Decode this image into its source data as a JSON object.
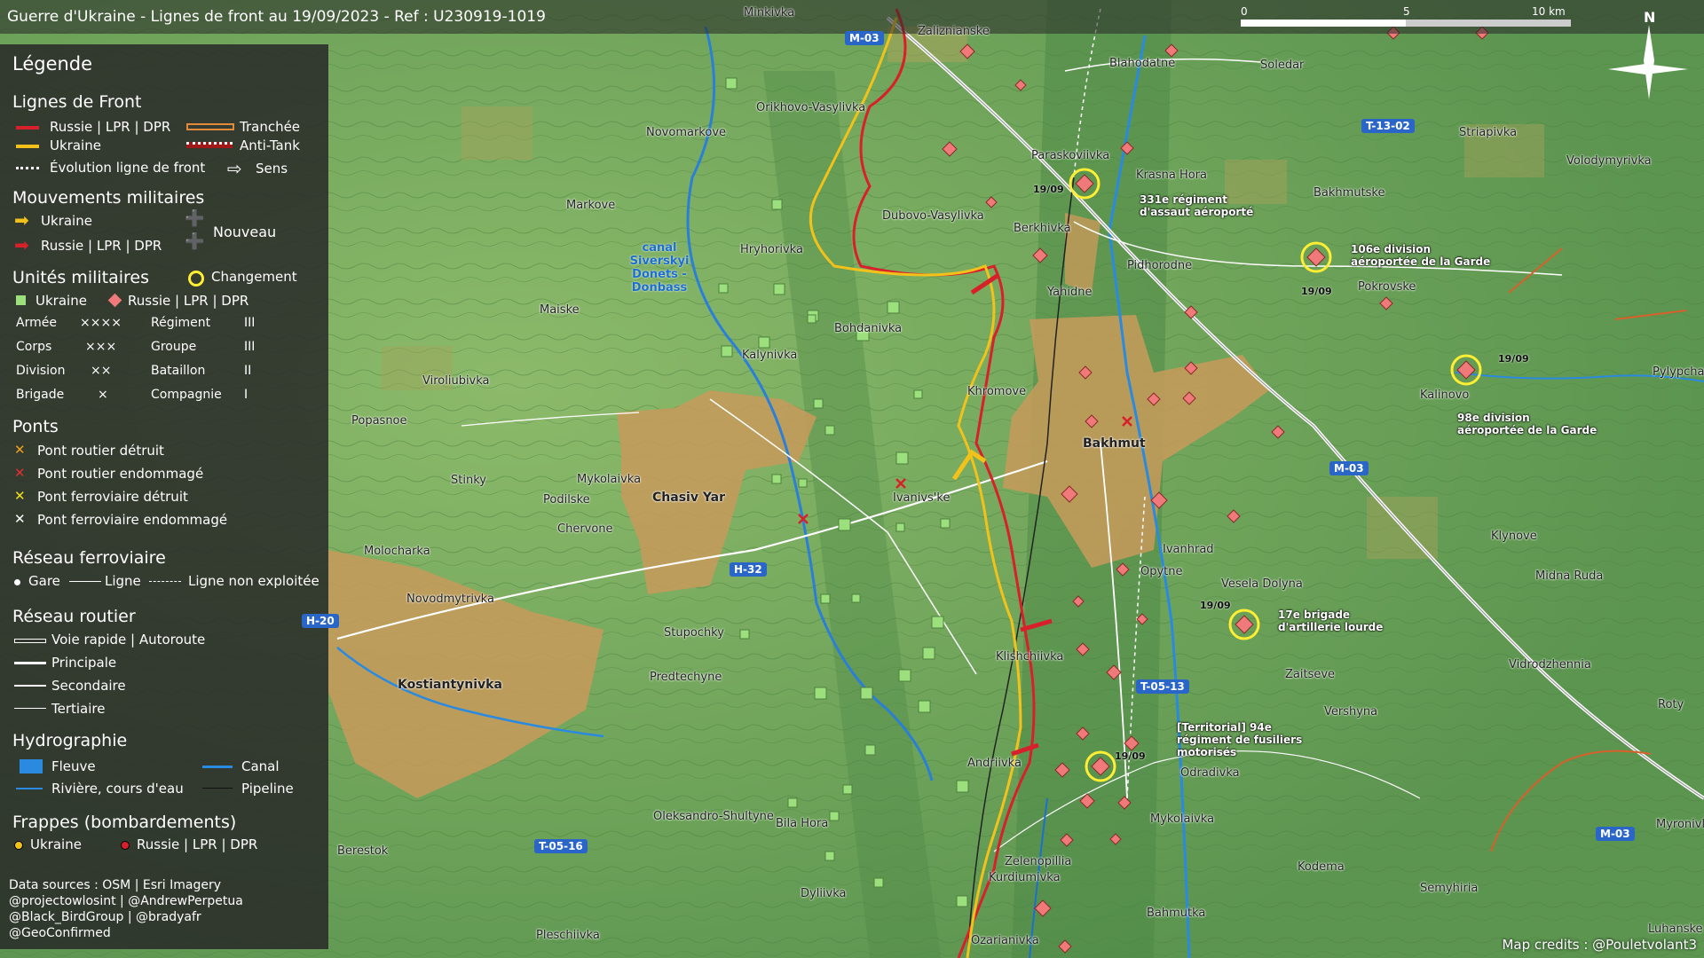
{
  "title": "Guerre d'Ukraine - Lignes de front au 19/09/2023 - Ref : U230919-1019",
  "scale": {
    "zero": "0",
    "mid": "5",
    "end": "10 km"
  },
  "north_label": "N",
  "legend": {
    "title": "Légende",
    "front_lines": {
      "heading": "Lignes de Front",
      "russia": "Russie | LPR | DPR",
      "ukraine": "Ukraine",
      "trench": "Tranchée",
      "antitank": "Anti-Tank",
      "evolution": "Évolution ligne de front",
      "direction": "Sens"
    },
    "movements": {
      "heading": "Mouvements militaires",
      "ukraine": "Ukraine",
      "russia": "Russie | LPR | DPR",
      "new": "Nouveau"
    },
    "units": {
      "heading": "Unités militaires",
      "change": "Changement",
      "ukraine": "Ukraine",
      "russia": "Russie | LPR | DPR",
      "rows": [
        {
          "left": "Armée",
          "left_sym": "××××",
          "right": "Régiment",
          "right_sym": "III"
        },
        {
          "left": "Corps",
          "left_sym": "×××",
          "right": "Groupe",
          "right_sym": "III"
        },
        {
          "left": "Division",
          "left_sym": "××",
          "right": "Bataillon",
          "right_sym": "II"
        },
        {
          "left": "Brigade",
          "left_sym": "×",
          "right": "Compagnie",
          "right_sym": "I"
        }
      ]
    },
    "bridges": {
      "heading": "Ponts",
      "items": [
        "Pont routier détruit",
        "Pont routier endommagé",
        "Pont ferroviaire détruit",
        "Pont ferroviaire endommagé"
      ]
    },
    "rail": {
      "heading": "Réseau ferroviaire",
      "station": "Gare",
      "line": "Ligne",
      "unused": "Ligne non exploitée"
    },
    "roads": {
      "heading": "Réseau routier",
      "items": [
        "Voie rapide | Autoroute",
        "Principale",
        "Secondaire",
        "Tertiaire"
      ]
    },
    "hydro": {
      "heading": "Hydrographie",
      "river_big": "Fleuve",
      "canal": "Canal",
      "river": "Rivière, cours d'eau",
      "pipeline": "Pipeline"
    },
    "strikes": {
      "heading": "Frappes (bombardements)",
      "ukraine": "Ukraine",
      "russia": "Russie | LPR | DPR"
    },
    "sources": [
      "Data sources : OSM | Esri Imagery",
      "@projectowlosint | @AndrewPerpetua",
      "@Black_BirdGroup | @bradyafr",
      "@GeoConfirmed"
    ]
  },
  "places": [
    "Minkivka",
    "Zaliznianske",
    "Blahodatne",
    "Soledar",
    "Orikhovo-Vasylivka",
    "Novomarkove",
    "Paraskoviivka",
    "Krasna Hora",
    "Striapivka",
    "Volodymyrivka",
    "Markove",
    "Dubovo-Vasylivka",
    "Berkhivka",
    "Bakhmutske",
    "Hryhorivka",
    "Pidhorodne",
    "Yahidne",
    "Pokrovske",
    "Maiske",
    "Bohdanivka",
    "Kalynivka",
    "Viroliubivka",
    "Khromove",
    "Kalinovo",
    "Pylypchatyne",
    "Popasnoe",
    "Stinky",
    "Mykolaivka",
    "Podilske",
    "Ivanivs'ke",
    "Chervone",
    "Molocharka",
    "Ivanhrad",
    "Klynove",
    "Opytne",
    "Vesela Dolyna",
    "Midna Ruda",
    "Novodmytrivka",
    "Stupochky",
    "Klishchiivka",
    "Zaitseve",
    "Vidrodzhennia",
    "Predtechyne",
    "Vershyna",
    "Roty",
    "Andriivka",
    "Odradivka",
    "Oleksandro-Shultyne",
    "Bila Hora",
    "Mykolaivka",
    "Myronivka",
    "Berestok",
    "Dyliivka",
    "Zelenopillia",
    "Kurdiumivka",
    "Kodema",
    "Semyhiria",
    "Bahmutka",
    "Pleschiivka",
    "Ozarianivka",
    "Luhanske"
  ],
  "cities": [
    "Bakhmut",
    "Chasiv Yar",
    "Kostiantynivka"
  ],
  "water_label": "canal Siverskyi Donets - Donbass",
  "roads": [
    "M-03",
    "T-13-02",
    "M-03",
    "H-32",
    "H-20",
    "T-05-13",
    "T-05-16",
    "M-03"
  ],
  "units": [
    {
      "label": "331e régiment d'assaut aéroporté",
      "date": "19/09"
    },
    {
      "label": "106e division aéroportée de la Garde",
      "date": "19/09"
    },
    {
      "label": "98e division aéroportée de la Garde",
      "date": "19/09"
    },
    {
      "label": "17e brigade d'artillerie lourde",
      "date": "19/09"
    },
    {
      "label": "[Territorial] 94e régiment de fusiliers motorisés",
      "date": "19/09"
    }
  ],
  "map_credit": "Map credits : @Pouletvolant3",
  "colors": {
    "russia": "#d8202a",
    "ukraine": "#f2c21a",
    "urban": "#c89a5a",
    "road_sign": "#2a66c8",
    "legend_bg": "#2c2c2c"
  }
}
